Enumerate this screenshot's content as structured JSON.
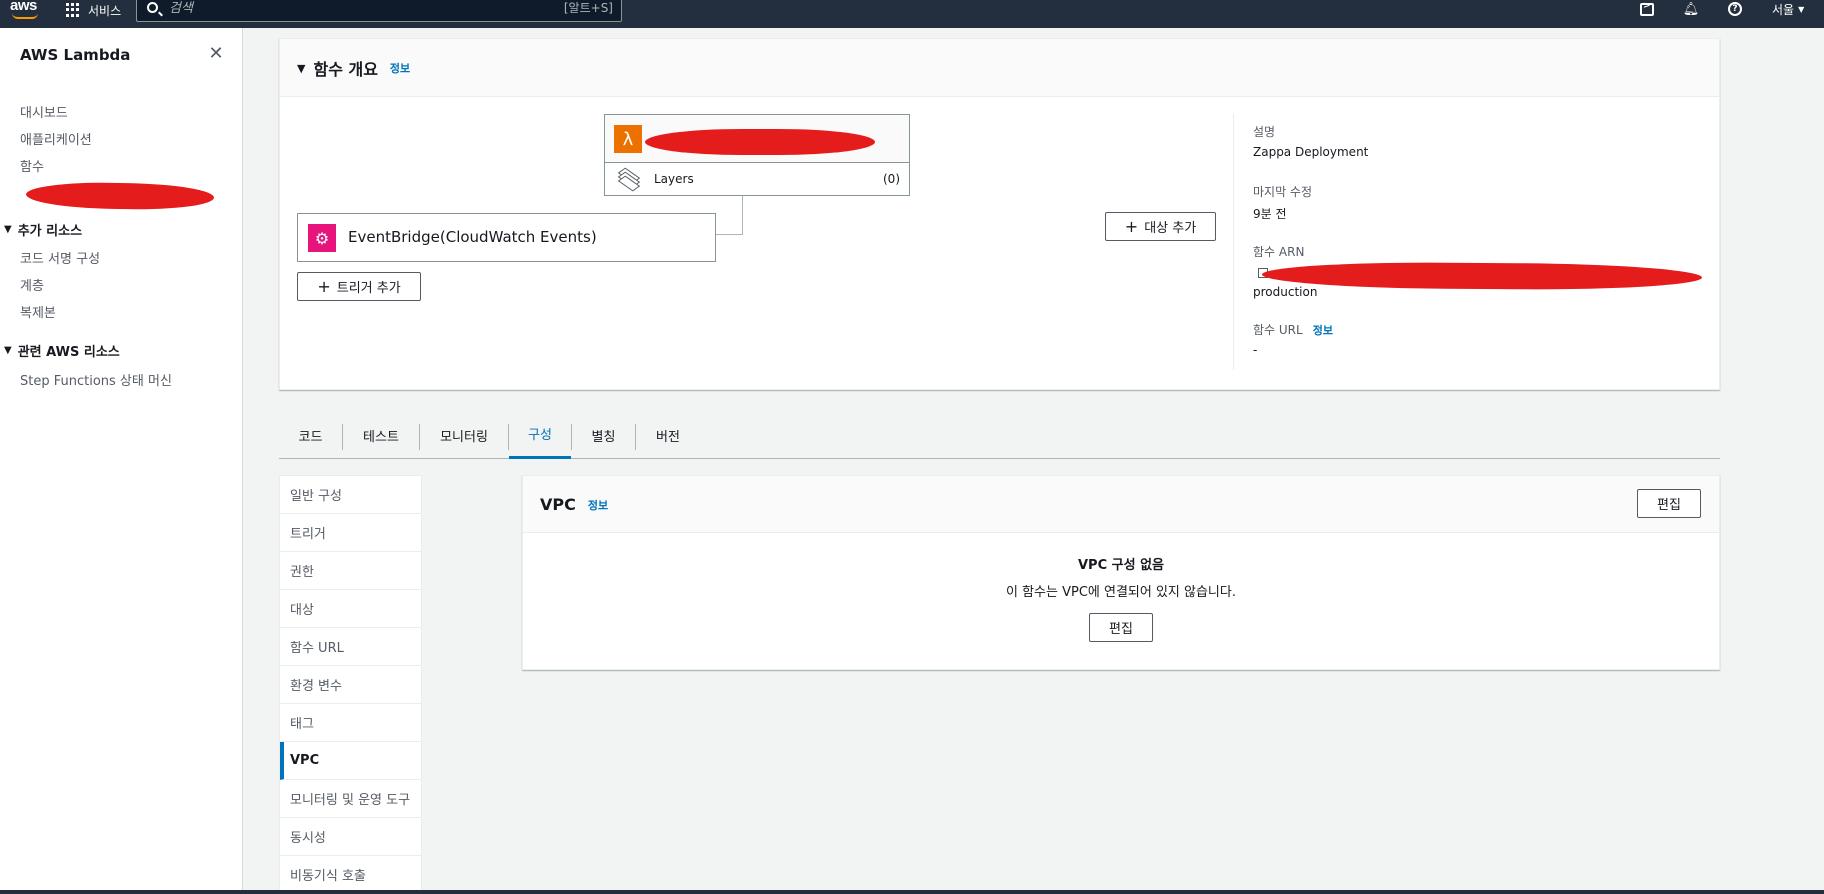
{
  "topnav": {
    "logo": "aws",
    "services_label": "서비스",
    "search_placeholder": "검색",
    "search_hint": "[알트+S]",
    "region": "서울"
  },
  "sidebar": {
    "title": "AWS Lambda",
    "links": [
      "대시보드",
      "애플리케이션",
      "함수"
    ],
    "section1": "추가 리소스",
    "section1_links": [
      "코드 서명 구성",
      "계층",
      "복제본"
    ],
    "section2": "관련 AWS 리소스",
    "section2_links": [
      "Step Functions 상태 머신"
    ]
  },
  "overview": {
    "title": "함수 개요",
    "info": "정보",
    "layers_label": "Layers",
    "layers_count": "(0)",
    "trigger_label": "EventBridge(CloudWatch Events)",
    "add_trigger": "트리거 추가",
    "add_destination": "대상 추가",
    "description_label": "설명",
    "description_value": "Zappa Deployment",
    "modified_label": "마지막 수정",
    "modified_value": "9분 전",
    "arn_label": "함수 ARN",
    "arn_suffix": "production",
    "url_label": "함수 URL",
    "url_info": "정보",
    "url_value": "-"
  },
  "tabs": [
    "코드",
    "테스트",
    "모니터링",
    "구성",
    "별칭",
    "버전"
  ],
  "active_tab": "구성",
  "config_nav": [
    "일반 구성",
    "트리거",
    "권한",
    "대상",
    "함수 URL",
    "환경 변수",
    "태그",
    "VPC",
    "모니터링 및 운영 도구",
    "동시성",
    "비동기식 호출"
  ],
  "active_config": "VPC",
  "vpc": {
    "title": "VPC",
    "info": "정보",
    "edit": "편집",
    "empty_title": "VPC 구성 없음",
    "empty_desc": "이 함수는 VPC에 연결되어 있지 않습니다.",
    "empty_edit": "편집"
  },
  "colors": {
    "nav_bg": "#232f3e",
    "link_blue": "#0073bb",
    "lambda_orange": "#ed7100",
    "eventbridge_pink": "#e7157b",
    "redaction": "#e51c1c"
  }
}
